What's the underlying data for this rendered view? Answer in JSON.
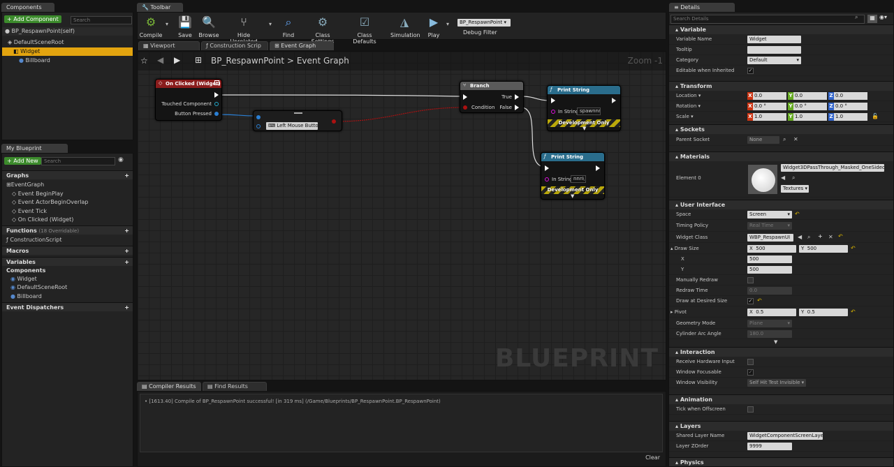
{
  "components_panel": {
    "tab": "Components",
    "add_button": "+ Add Component",
    "search_placeholder": "Search",
    "self_item": "BP_RespawnPoint(self)",
    "tree": [
      "DefaultSceneRoot",
      "Widget",
      "Billboard"
    ]
  },
  "my_blueprint": {
    "tab": "My Blueprint",
    "add_button": "+ Add New",
    "search_placeholder": "Search",
    "graphs_header": "Graphs",
    "event_graph": "EventGraph",
    "events": [
      "Event BeginPlay",
      "Event ActorBeginOverlap",
      "Event Tick",
      "On Clicked (Widget)"
    ],
    "functions_header": "Functions",
    "functions_note": "(18 Overridable)",
    "functions": [
      "ConstructionScript"
    ],
    "macros_header": "Macros",
    "variables_header": "Variables",
    "components_sub": "Components",
    "variables": [
      "Widget",
      "DefaultSceneRoot",
      "Billboard"
    ],
    "dispatchers_header": "Event Dispatchers"
  },
  "toolbar": {
    "tab": "Toolbar",
    "items": [
      {
        "label": "Compile",
        "icon": "compile-icon"
      },
      {
        "label": "Save",
        "icon": "save-icon"
      },
      {
        "label": "Browse",
        "icon": "browse-icon"
      },
      {
        "label": "Hide Unrelated",
        "icon": "hide-unrelated-icon"
      },
      {
        "label": "Find",
        "icon": "find-icon"
      },
      {
        "label": "Class Settings",
        "icon": "class-settings-icon"
      },
      {
        "label": "Class Defaults",
        "icon": "class-defaults-icon"
      },
      {
        "label": "Simulation",
        "icon": "simulation-icon"
      },
      {
        "label": "Play",
        "icon": "play-icon"
      }
    ],
    "debug_object": "BP_RespawnPoint",
    "debug_filter": "Debug Filter"
  },
  "editor_tabs": [
    "Viewport",
    "Construction Scrip",
    "Event Graph"
  ],
  "graph": {
    "breadcrumb_root": "BP_RespawnPoint",
    "breadcrumb_sep": ">",
    "breadcrumb_leaf": "Event Graph",
    "zoom": "Zoom -1",
    "watermark": "BLUEPRINT",
    "nodes": {
      "on_clicked": {
        "title": "On Clicked (Widget)",
        "pin1": "Touched Component",
        "pin2": "Button Pressed"
      },
      "key": {
        "value": "Left Mouse Button"
      },
      "branch": {
        "title": "Branch",
        "cond": "Condition",
        "true": "True",
        "false": "False"
      },
      "print1": {
        "title": "Print String",
        "pin": "In String",
        "value": "spawnnn",
        "dev": "Development Only"
      },
      "print2": {
        "title": "Print String",
        "pin": "In String",
        "value": "nnn\\",
        "dev": "Development Only"
      }
    }
  },
  "bottom": {
    "tabs": [
      "Compiler Results",
      "Find Results"
    ],
    "log": "[1613.40] Compile of BP_RespawnPoint successful! [in 319 ms] (/Game/Blueprints/BP_RespawnPoint.BP_RespawnPoint)",
    "clear": "Clear"
  },
  "details": {
    "tab": "Details",
    "search_placeholder": "Search Details",
    "variable": {
      "header": "Variable",
      "name_label": "Variable Name",
      "name": "Widget",
      "tooltip_label": "Tooltip",
      "category_label": "Category",
      "category": "Default",
      "editable_label": "Editable when Inherited"
    },
    "transform": {
      "header": "Transform",
      "location": "Location",
      "rotation": "Rotation",
      "scale": "Scale",
      "loc": [
        "0.0",
        "0.0",
        "0.0"
      ],
      "rot": [
        "0.0 °",
        "0.0 °",
        "0.0 °"
      ],
      "scl": [
        "1.0",
        "1.0",
        "1.0"
      ]
    },
    "sockets": {
      "header": "Sockets",
      "label": "Parent Socket",
      "value": "None"
    },
    "materials": {
      "header": "Materials",
      "label": "Element 0",
      "value": "Widget3DPassThrough_Masked_OneSided",
      "textures": "Textures"
    },
    "ui": {
      "header": "User Interface",
      "space_label": "Space",
      "space": "Screen",
      "timing_label": "Timing Policy",
      "timing": "Real Time",
      "widget_class_label": "Widget Class",
      "widget_class": "WBP_RespawnUI",
      "draw_size_label": "Draw Size",
      "draw_x": "500",
      "draw_y": "500",
      "x_label": "X",
      "y_label": "Y",
      "manual_label": "Manually Redraw",
      "redraw_label": "Redraw Time",
      "redraw": "0.0",
      "desired_label": "Draw at Desired Size",
      "pivot_label": "Pivot",
      "pivot_x": "0.5",
      "pivot_y": "0.5",
      "geometry_label": "Geometry Mode",
      "geometry": "Plane",
      "cyl_label": "Cylinder Arc Angle",
      "cyl": "180.0"
    },
    "interaction": {
      "header": "Interaction",
      "receive": "Receive Hardware Input",
      "focusable": "Window Focusable",
      "visibility_label": "Window Visibility",
      "visibility": "Self Hit Test Invisible"
    },
    "animation": {
      "header": "Animation",
      "tick": "Tick when Offscreen"
    },
    "layers": {
      "header": "Layers",
      "shared_label": "Shared Layer Name",
      "shared": "WidgetComponentScreenLayer",
      "zorder_label": "Layer ZOrder",
      "zorder": "9999"
    },
    "physics": {
      "header": "Physics"
    }
  }
}
